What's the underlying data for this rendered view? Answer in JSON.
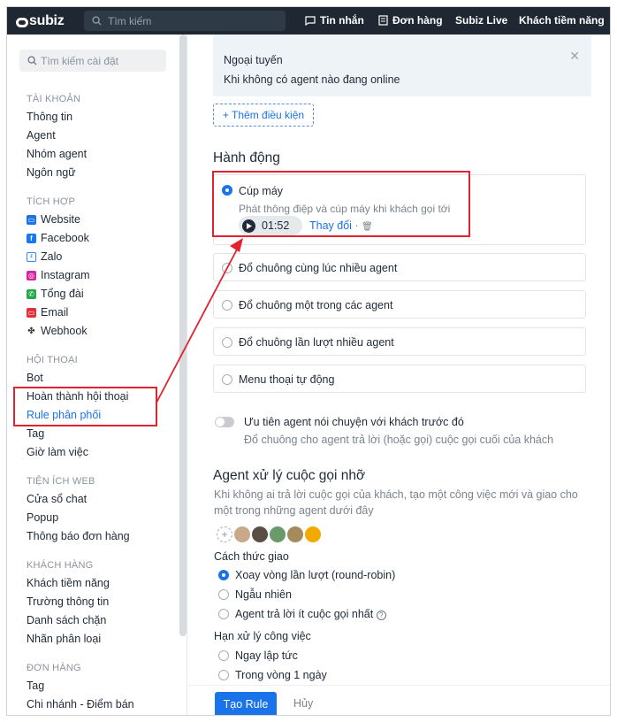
{
  "topbar": {
    "logo": "subiz",
    "search_placeholder": "Tìm kiếm",
    "nav": [
      "Tin nhắn",
      "Đơn hàng",
      "Subiz Live",
      "Khách tiềm năng"
    ]
  },
  "sidebar": {
    "search_placeholder": "Tìm kiếm cài đặt",
    "sections": {
      "account": {
        "title": "TÀI KHOẢN",
        "items": [
          "Thông tin",
          "Agent",
          "Nhóm agent",
          "Ngôn ngữ"
        ]
      },
      "integration": {
        "title": "TÍCH HỢP",
        "items": [
          "Website",
          "Facebook",
          "Zalo",
          "Instagram",
          "Tổng đài",
          "Email",
          "Webhook"
        ]
      },
      "conversation": {
        "title": "HỘI THOẠI",
        "items": [
          "Bot",
          "Hoàn thành hội thoại",
          "Rule phân phối",
          "Tag",
          "Giờ làm việc"
        ]
      },
      "web_utils": {
        "title": "TIỆN ÍCH WEB",
        "items": [
          "Cửa sổ chat",
          "Popup",
          "Thông báo đơn hàng"
        ]
      },
      "customer": {
        "title": "KHÁCH HÀNG",
        "items": [
          "Khách tiềm năng",
          "Trường thông tin",
          "Danh sách chặn",
          "Nhãn phân loại"
        ]
      },
      "order": {
        "title": "ĐƠN HÀNG",
        "items": [
          "Tag",
          "Chi nhánh - Điểm bán"
        ]
      }
    },
    "active_item": "Rule phân phối"
  },
  "condition": {
    "title": "Ngoại tuyến",
    "desc": "Khi không có agent nào đang online",
    "add_label": "+ Thêm điều kiện"
  },
  "actions": {
    "title": "Hành động",
    "selected": {
      "label": "Cúp máy",
      "desc": "Phát thông điệp và cúp máy khi khách gọi tới",
      "duration": "01:52",
      "change_label": "Thay đổi"
    },
    "options": [
      "Đổ chuông cùng lúc nhiều agent",
      "Đổ chuông một trong các agent",
      "Đổ chuông lần lượt nhiều agent",
      "Menu thoại tự động"
    ]
  },
  "priority": {
    "label": "Ưu tiên agent nói chuyện với khách trước đó",
    "desc": "Đổ chuông cho agent trả lời (hoặc gọi) cuộc gọi cuối của khách",
    "enabled": false
  },
  "missed": {
    "title": "Agent xử lý cuộc gọi nhỡ",
    "desc_line1": "Khi không ai trả lời cuộc gọi của khách, tạo một công việc mới và giao cho",
    "desc_line2": "một trong những agent dưới đây",
    "assign_title": "Cách thức giao",
    "assign_options": [
      "Xoay vòng lần lượt (round-robin)",
      "Ngẫu nhiên",
      "Agent trả lời ít cuộc gọi nhất"
    ],
    "assign_selected": 0,
    "deadline_title": "Hạn xử lý công việc",
    "deadline_options": [
      "Ngay lập tức",
      "Trong vòng 1 ngày"
    ]
  },
  "footer": {
    "create_label": "Tạo Rule",
    "cancel_label": "Hủy"
  },
  "colors": {
    "accent": "#1a73e8",
    "topbar": "#1e2732",
    "annotation": "#e0232e"
  }
}
